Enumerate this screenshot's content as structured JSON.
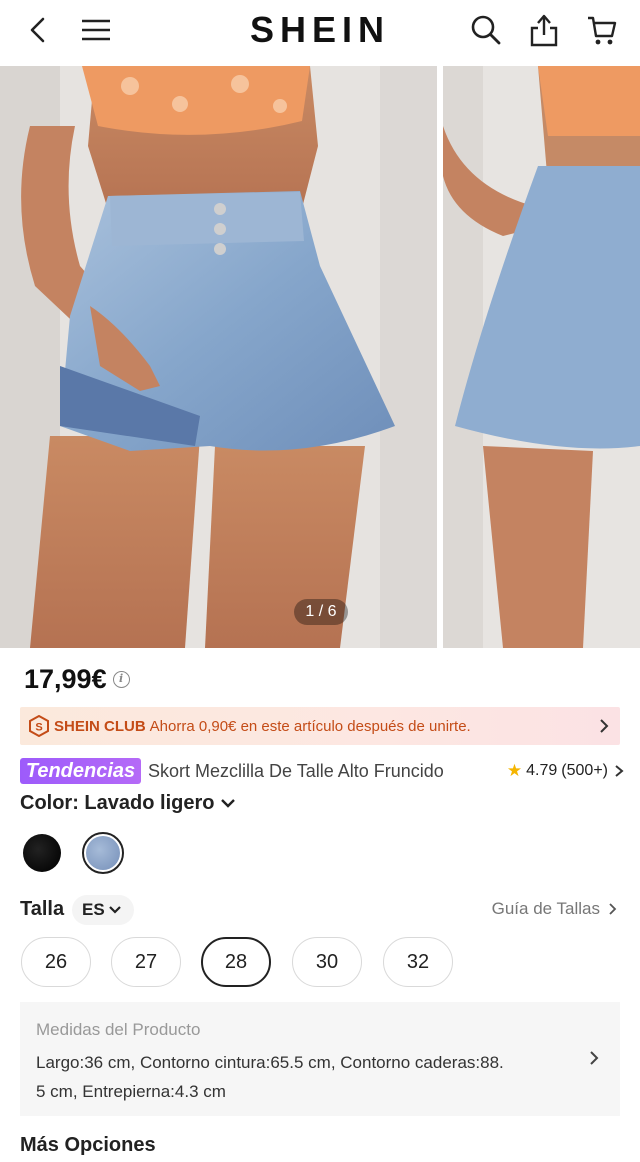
{
  "header": {
    "logo": "SHEIN"
  },
  "gallery": {
    "counter": "1 / 6"
  },
  "price": {
    "value": "17,99€"
  },
  "club": {
    "brand": "SHEIN CLUB",
    "text": "Ahorra 0,90€ en este artículo después de unirte."
  },
  "product": {
    "badge": "Tendencias",
    "title": "Skort Mezclilla De Talle Alto Fruncido",
    "rating": "4.79",
    "reviews": "(500+)"
  },
  "color": {
    "label": "Color: Lavado ligero",
    "swatches": [
      "black",
      "light-wash"
    ],
    "selected_index": 1
  },
  "size": {
    "label": "Talla",
    "unit": "ES",
    "guide": "Guía de Tallas",
    "options": [
      "26",
      "27",
      "28",
      "30",
      "32"
    ],
    "selected": "28"
  },
  "measurements": {
    "title": "Medidas del Producto",
    "line1": "Largo:36 cm,   Contorno cintura:65.5 cm,   Contorno caderas:88.",
    "line2": "5 cm,   Entrepierna:4.3 cm"
  },
  "more_options": "Más Opciones",
  "colors": {
    "club_text": "#c44c17",
    "badge": "#a55ffa",
    "star": "#f5b500"
  }
}
